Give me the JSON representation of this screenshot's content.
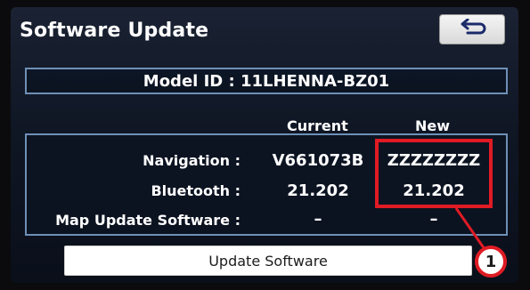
{
  "screen": {
    "title": "Software Update",
    "back_icon": "return-arrow-icon"
  },
  "model": {
    "text": "Model ID : 11LHENNA-BZ01"
  },
  "columns": {
    "current": "Current",
    "new": "New"
  },
  "rows": [
    {
      "label": "Navigation :",
      "current": "V661073B",
      "new": "ZZZZZZZZ"
    },
    {
      "label": "Bluetooth :",
      "current": "21.202",
      "new": "21.202"
    },
    {
      "label": "Map Update Software :",
      "current": "–",
      "new": "–"
    }
  ],
  "actions": {
    "update_label": "Update Software"
  },
  "annotation": {
    "callout_number": "1",
    "highlight_color": "#e01b24"
  },
  "colors": {
    "frame_blue": "#6f8fb6",
    "screen_bg": "#0f1624"
  }
}
